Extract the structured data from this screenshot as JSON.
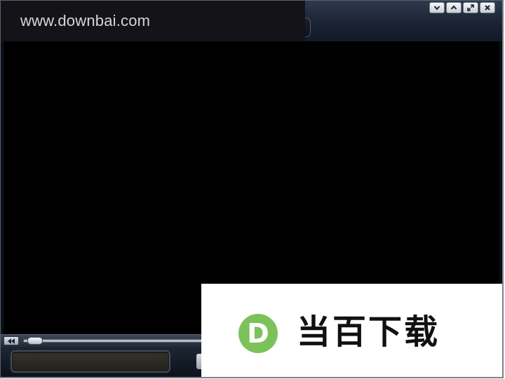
{
  "titlebar": {
    "brand_label": "www.downbai.com"
  },
  "window_controls": [
    {
      "name": "minimize",
      "icon": "chevron-down-icon"
    },
    {
      "name": "restore",
      "icon": "chevron-up-icon"
    },
    {
      "name": "maximize",
      "icon": "expand-icon"
    },
    {
      "name": "close",
      "icon": "close-icon"
    }
  ],
  "seekbar": {
    "rewind_icon": "rewind-icon",
    "position": 0
  },
  "watermark": {
    "logo_letter": "D",
    "text": "当百下载",
    "logo_color": "#7cc25a"
  },
  "colors": {
    "frame": "#1c2535",
    "video_bg": "#000000"
  }
}
